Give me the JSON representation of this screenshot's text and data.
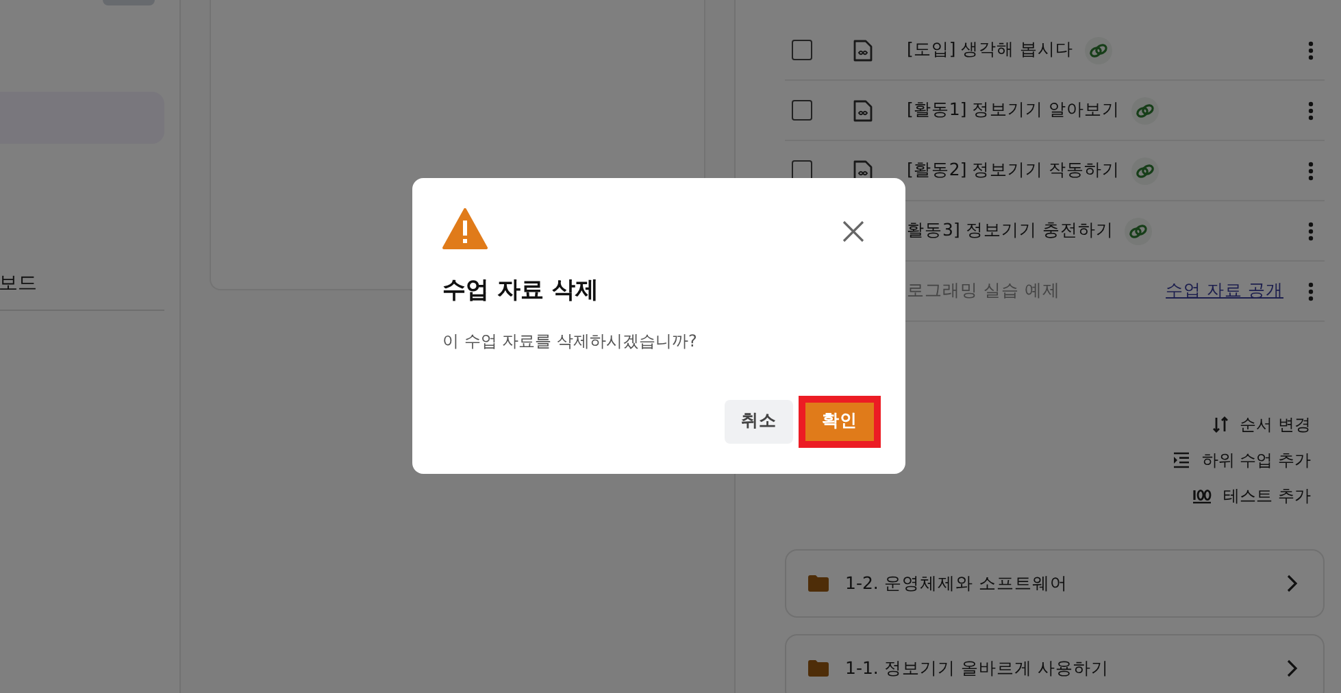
{
  "sidebar": {
    "items": [
      {
        "label": "보드"
      }
    ]
  },
  "materials": [
    {
      "kind": "link",
      "checked": false,
      "title": "[도입] 생각해 봅시다"
    },
    {
      "kind": "link",
      "checked": false,
      "title": "[활동1] 정보기기 알아보기"
    },
    {
      "kind": "link",
      "checked": false,
      "title": "[활동2] 정보기기 작동하기"
    },
    {
      "kind": "link",
      "title": "활동3] 정보기기 충전하기"
    },
    {
      "kind": "draft",
      "title": "로그래밍 실습 예제",
      "action": "수업 자료 공개"
    }
  ],
  "actions": [
    {
      "kind": "sort",
      "label": "순서 변경"
    },
    {
      "kind": "indent",
      "label": "하위 수업 추가"
    },
    {
      "kind": "test",
      "label": "테스트 추가"
    }
  ],
  "folders": [
    {
      "label": "1-2. 운영체제와 소프트웨어"
    },
    {
      "label": "1-1. 정보기기 올바르게 사용하기"
    }
  ],
  "dialog": {
    "title": "수업 자료 삭제",
    "message": "이 수업 자료를 삭제하시겠습니까?",
    "buttons": [
      {
        "kind": "secondary",
        "label": "취소",
        "highlighted": false
      },
      {
        "kind": "primary",
        "label": "확인",
        "highlighted": true
      }
    ]
  }
}
